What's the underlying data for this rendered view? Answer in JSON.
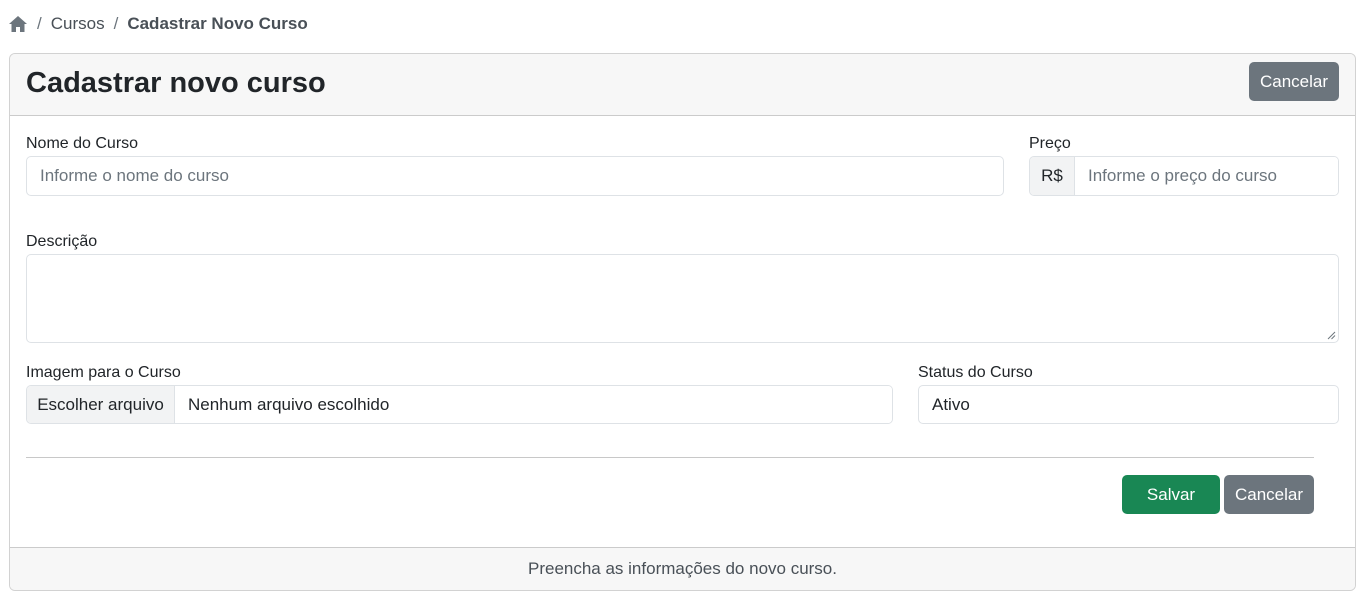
{
  "breadcrumb": {
    "home_icon": "home-icon",
    "items": [
      "Cursos",
      "Cadastrar Novo Curso"
    ],
    "separator": "/"
  },
  "card": {
    "title": "Cadastrar novo curso",
    "header_cancel_label": "Cancelar",
    "footer_text": "Preencha as informações do novo curso."
  },
  "form": {
    "name": {
      "label": "Nome do Curso",
      "placeholder": "Informe o nome do curso",
      "value": ""
    },
    "price": {
      "label": "Preço",
      "currency": "R$",
      "placeholder": "Informe o preço do curso",
      "value": ""
    },
    "description": {
      "label": "Descrição",
      "value": ""
    },
    "image": {
      "label": "Imagem para o Curso",
      "button_label": "Escolher arquivo",
      "file_status": "Nenhum arquivo escolhido"
    },
    "status": {
      "label": "Status do Curso",
      "value": "Ativo"
    }
  },
  "actions": {
    "save_label": "Salvar",
    "cancel_label": "Cancelar"
  },
  "colors": {
    "success": "#198754",
    "secondary": "#6c757d"
  }
}
